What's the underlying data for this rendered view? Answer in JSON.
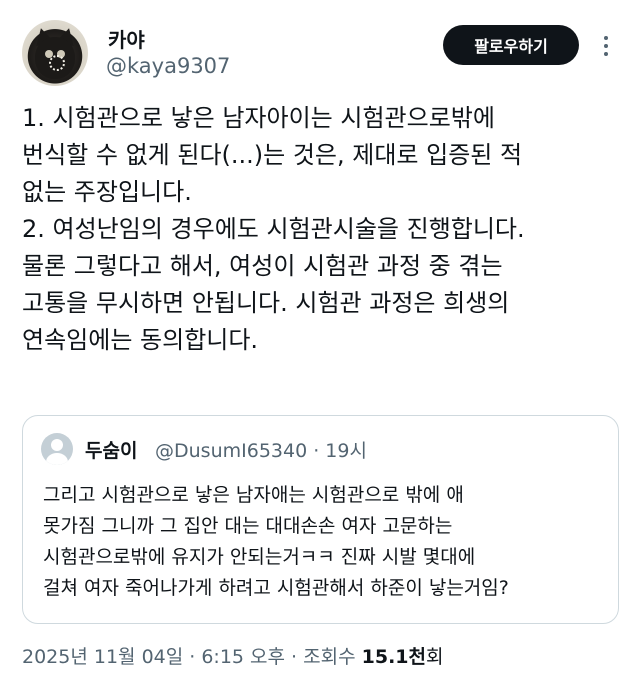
{
  "author": {
    "display_name": "카야",
    "handle": "@kaya9307"
  },
  "follow_label": "팔로우하기",
  "tweet_lines": [
    "1. 시험관으로 낳은 남자아이는 시험관으로밖에",
    "번식할 수 없게 된다(...)는 것은, 제대로 입증된 적",
    "없는 주장입니다.",
    "2. 여성난임의 경우에도 시험관시술을 진행합니다.",
    "물론 그렇다고 해서, 여성이 시험관 과정 중 겪는",
    "고통을 무시하면 안됩니다. 시험관 과정은 희생의",
    "연속임에는 동의합니다."
  ],
  "quoted": {
    "display_name": "두숨이",
    "handle_time": "@DusumI65340 · 19시",
    "lines": [
      "그리고 시험관으로 낳은 남자애는 시험관으로 밖에 애",
      "못가짐 그니까 그 집안 대는 대대손손 여자 고문하는",
      "시험관으로밖에 유지가 안되는거ㅋㅋ 진짜 시발 몇대에",
      "걸쳐 여자 죽어나가게 하려고 시험관해서 하준이 낳는거임?"
    ]
  },
  "meta": {
    "timestamp": "2025년 11월 04일 · 6:15 오후 · 조회수 ",
    "views_count": "15.1천",
    "views_unit": "회"
  },
  "icons": {
    "more": "more-horizontal-icon",
    "default_avatar": "default-avatar-icon"
  },
  "colors": {
    "text": "#0f1419",
    "secondary": "#536471",
    "button_bg": "#0f1419",
    "border": "#cfd9de"
  }
}
